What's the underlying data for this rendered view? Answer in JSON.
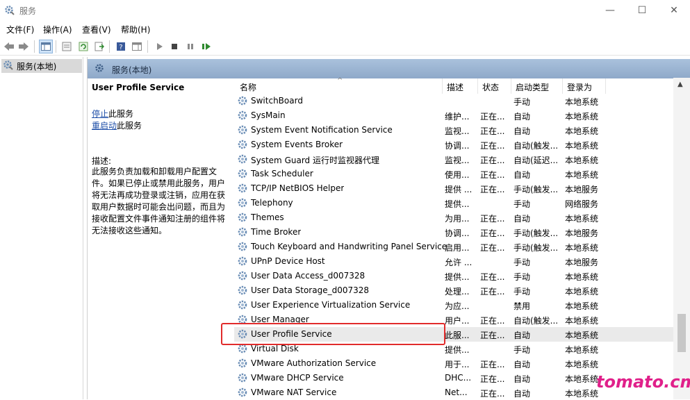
{
  "window": {
    "title": "服务"
  },
  "menu": [
    "文件(F)",
    "操作(A)",
    "查看(V)",
    "帮助(H)"
  ],
  "tree": {
    "root_label": "服务(本地)"
  },
  "panel": {
    "header_label": "服务(本地)"
  },
  "details": {
    "service_name": "User Profile Service",
    "stop_link": "停止",
    "stop_suffix": "此服务",
    "restart_link": "重启动",
    "restart_suffix": "此服务",
    "desc_label": "描述:",
    "desc_text": "此服务负责加载和卸载用户配置文件。如果已停止或禁用此服务，用户将无法再成功登录或注销，应用在获取用户数据时可能会出问题，而且为接收配置文件事件通知注册的组件将无法接收这些通知。"
  },
  "columns": {
    "name": "名称",
    "desc": "描述",
    "status": "状态",
    "startup": "启动类型",
    "logon": "登录为"
  },
  "rows": [
    {
      "name": "SwitchBoard",
      "desc": "",
      "status": "",
      "startup": "手动",
      "logon": "本地系统"
    },
    {
      "name": "SysMain",
      "desc": "维护...",
      "status": "正在...",
      "startup": "自动",
      "logon": "本地系统"
    },
    {
      "name": "System Event Notification Service",
      "desc": "监视...",
      "status": "正在...",
      "startup": "自动",
      "logon": "本地系统"
    },
    {
      "name": "System Events Broker",
      "desc": "协调...",
      "status": "正在...",
      "startup": "自动(触发...",
      "logon": "本地系统"
    },
    {
      "name": "System Guard 运行时监视器代理",
      "desc": "监视...",
      "status": "正在...",
      "startup": "自动(延迟...",
      "logon": "本地系统"
    },
    {
      "name": "Task Scheduler",
      "desc": "使用...",
      "status": "正在...",
      "startup": "自动",
      "logon": "本地系统"
    },
    {
      "name": "TCP/IP NetBIOS Helper",
      "desc": "提供 ...",
      "status": "正在...",
      "startup": "手动(触发...",
      "logon": "本地服务"
    },
    {
      "name": "Telephony",
      "desc": "提供...",
      "status": "",
      "startup": "手动",
      "logon": "网络服务"
    },
    {
      "name": "Themes",
      "desc": "为用...",
      "status": "正在...",
      "startup": "自动",
      "logon": "本地系统"
    },
    {
      "name": "Time Broker",
      "desc": "协调...",
      "status": "正在...",
      "startup": "手动(触发...",
      "logon": "本地服务"
    },
    {
      "name": "Touch Keyboard and Handwriting Panel Service",
      "desc": "启用...",
      "status": "正在...",
      "startup": "手动(触发...",
      "logon": "本地系统"
    },
    {
      "name": "UPnP Device Host",
      "desc": "允许 ...",
      "status": "",
      "startup": "手动",
      "logon": "本地服务"
    },
    {
      "name": "User Data Access_d007328",
      "desc": "提供...",
      "status": "正在...",
      "startup": "手动",
      "logon": "本地系统"
    },
    {
      "name": "User Data Storage_d007328",
      "desc": "处理...",
      "status": "正在...",
      "startup": "手动",
      "logon": "本地系统"
    },
    {
      "name": "User Experience Virtualization Service",
      "desc": "为应...",
      "status": "",
      "startup": "禁用",
      "logon": "本地系统"
    },
    {
      "name": "User Manager",
      "desc": "用户...",
      "status": "正在...",
      "startup": "自动(触发...",
      "logon": "本地系统"
    },
    {
      "name": "User Profile Service",
      "desc": "此服...",
      "status": "正在...",
      "startup": "自动",
      "logon": "本地系统",
      "selected": true
    },
    {
      "name": "Virtual Disk",
      "desc": "提供...",
      "status": "",
      "startup": "手动",
      "logon": "本地系统"
    },
    {
      "name": "VMware Authorization Service",
      "desc": "用于...",
      "status": "正在...",
      "startup": "自动",
      "logon": "本地系统"
    },
    {
      "name": "VMware DHCP Service",
      "desc": "DHC...",
      "status": "正在...",
      "startup": "自动",
      "logon": "本地系统"
    },
    {
      "name": "VMware NAT Service",
      "desc": "Net...",
      "status": "正在...",
      "startup": "自动",
      "logon": "本地系统"
    }
  ],
  "watermark": "tomato.cm",
  "colors": {
    "highlight": "#e12b2b",
    "header_blue": "#9bb4d3",
    "watermark": "#e0208a",
    "link": "#1f4fa8"
  }
}
